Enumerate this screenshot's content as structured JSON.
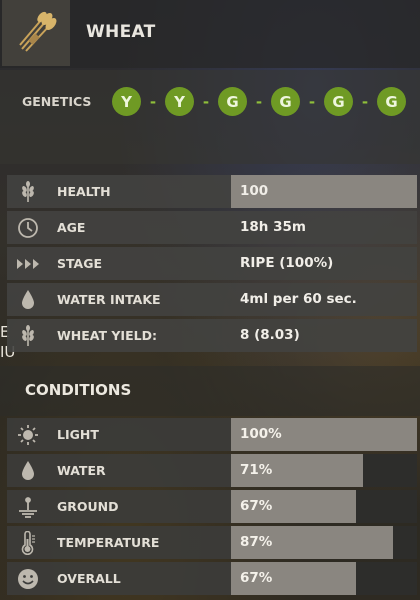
{
  "header": {
    "title": "WHEAT",
    "icon": "wheat-bundle-icon"
  },
  "genetics": {
    "label": "GENETICS",
    "genes": [
      "Y",
      "Y",
      "G",
      "G",
      "G",
      "G"
    ],
    "separator": "-",
    "gene_color": "#6f9a24"
  },
  "stats": [
    {
      "icon": "wheat-icon",
      "label": "HEALTH",
      "value": "100",
      "highlight": true
    },
    {
      "icon": "clock-icon",
      "label": "AGE",
      "value": "18h 35m",
      "highlight": false
    },
    {
      "icon": "stage-chevrons-icon",
      "label": "STAGE",
      "value": "RIPE (100%)",
      "highlight": false
    },
    {
      "icon": "water-drop-icon",
      "label": "WATER INTAKE",
      "value": "4ml per 60 sec.",
      "highlight": false
    },
    {
      "icon": "wheat-icon",
      "label": "WHEAT YIELD:",
      "value": "8 (8.03)",
      "highlight": false
    }
  ],
  "conditions": {
    "title": "CONDITIONS",
    "items": [
      {
        "icon": "sun-icon",
        "label": "LIGHT",
        "value": "100%",
        "level": 1.0
      },
      {
        "icon": "water-drop-icon",
        "label": "WATER",
        "value": "71%",
        "level": 0.71
      },
      {
        "icon": "ground-icon",
        "label": "GROUND",
        "value": "67%",
        "level": 0.67
      },
      {
        "icon": "thermometer-icon",
        "label": "TEMPERATURE",
        "value": "87%",
        "level": 0.87
      },
      {
        "icon": "smiley-icon",
        "label": "OVERALL",
        "value": "67%",
        "level": 0.67
      }
    ]
  },
  "edge_text": [
    "E",
    "IU"
  ]
}
